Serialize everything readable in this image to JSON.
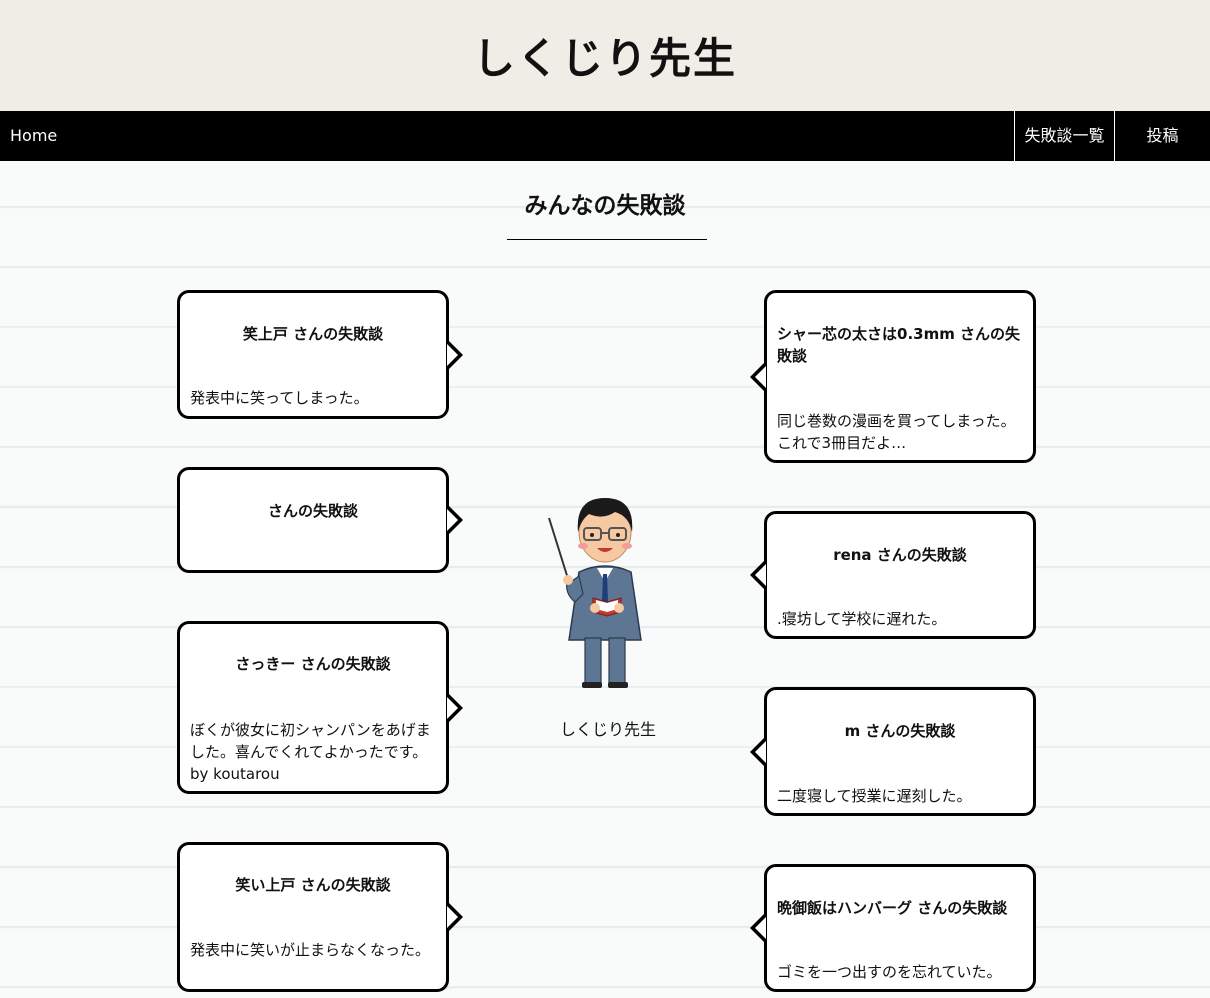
{
  "site": {
    "title": "しくじり先生"
  },
  "nav": {
    "home": "Home",
    "list": "失敗談一覧",
    "post": "投稿"
  },
  "main": {
    "heading": "みんなの失敗談",
    "teacher_caption": "しくじり先生",
    "teacher_icon": "teacher-illustration"
  },
  "left_posts": [
    {
      "name": "笑上戸 さんの失敗談",
      "text": "発表中に笑ってしまった。"
    },
    {
      "name": "さんの失敗談",
      "text": ""
    },
    {
      "name": "さっきー さんの失敗談",
      "text": "ぼくが彼女に初シャンパンをあげました。喜んでくれてよかったです。by koutarou"
    },
    {
      "name": "笑い上戸 さんの失敗談",
      "text": "発表中に笑いが止まらなくなった。"
    }
  ],
  "right_posts": [
    {
      "name": "シャー芯の太さは0.3mm さんの失敗談",
      "text": "同じ巻数の漫画を買ってしまった。これで3冊目だよ…"
    },
    {
      "name": "rena さんの失敗談",
      "text": ".寝坊して学校に遅れた。"
    },
    {
      "name": "m さんの失敗談",
      "text": "二度寝して授業に遅刻した。"
    },
    {
      "name": "晩御飯はハンバーグ さんの失敗談",
      "text": "ゴミを一つ出すのを忘れていた。"
    }
  ]
}
